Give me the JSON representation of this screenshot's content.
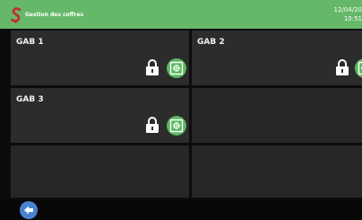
{
  "header": {
    "title": "Gestion des coffres",
    "date": "12/04/20",
    "time": "10:51",
    "logo_icon": "s-logo-icon",
    "logo_color": "#c62828",
    "background": "#65b86a"
  },
  "safes": [
    {
      "label": "GAB 1",
      "status_icon": "lock-icon",
      "action_icon": "safe-icon"
    },
    {
      "label": "GAB 2",
      "status_icon": "lock-icon",
      "action_icon": "safe-icon"
    },
    {
      "label": "GAB 3",
      "status_icon": "lock-icon",
      "action_icon": "safe-icon"
    }
  ],
  "footer": {
    "back_icon": "back-arrow-icon",
    "back_color": "#4a82d2"
  }
}
